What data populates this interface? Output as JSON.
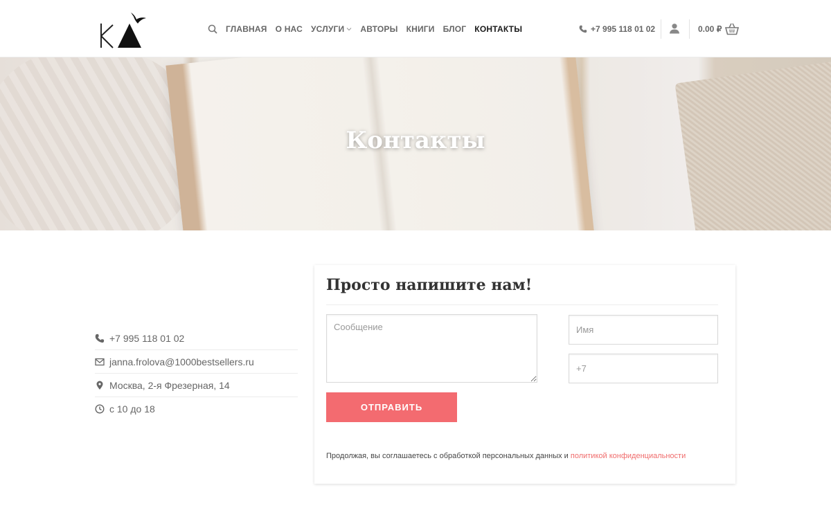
{
  "header": {
    "logo_text": "KA",
    "nav": [
      {
        "label": "ГЛАВНАЯ",
        "active": false
      },
      {
        "label": "О НАС",
        "active": false
      },
      {
        "label": "УСЛУГИ",
        "active": false,
        "has_dropdown": true
      },
      {
        "label": "АВТОРЫ",
        "active": false
      },
      {
        "label": "КНИГИ",
        "active": false
      },
      {
        "label": "БЛОГ",
        "active": false
      },
      {
        "label": "КОНТАКТЫ",
        "active": true
      }
    ],
    "phone": "+7 995 118 01 02",
    "cart_total": "0.00 ₽",
    "icons": [
      "search-icon",
      "phone-icon",
      "user-icon",
      "basket-icon"
    ]
  },
  "hero": {
    "title": "Контакты"
  },
  "contact_info": [
    {
      "icon": "phone-icon",
      "text": "+7 995 118 01 02"
    },
    {
      "icon": "envelope-icon",
      "text": "janna.frolova@1000bestsellers.ru"
    },
    {
      "icon": "map-pin-icon",
      "text": "Москва, 2-я Фрезерная, 14"
    },
    {
      "icon": "clock-icon",
      "text": "с 10 до 18"
    }
  ],
  "form": {
    "title": "Просто напишите нам!",
    "message_placeholder": "Сообщение",
    "name_placeholder": "Имя",
    "phone_placeholder": "+7",
    "submit_label": "ОТПРАВИТЬ",
    "consent_text": "Продолжая, вы соглашаетесь с обработкой персональных данных и ",
    "consent_link": "политикой конфиденциальности"
  },
  "colors": {
    "accent": "#f36b70",
    "link": "#f06b6b",
    "text": "#666666",
    "active_nav": "#1a1a1a"
  }
}
